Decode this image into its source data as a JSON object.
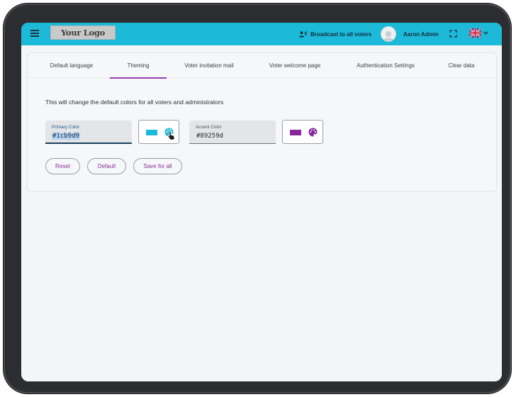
{
  "header": {
    "logo_text": "Your Logo",
    "broadcast_label": "Broadcast to all voters",
    "user_name": "Aaron Admin",
    "primary_color": "#1cb9d9"
  },
  "tabs": [
    {
      "label": "Default language",
      "active": false
    },
    {
      "label": "Theming",
      "active": true
    },
    {
      "label": "Voter invitation mail",
      "active": false
    },
    {
      "label": "Voter welcome page",
      "active": false
    },
    {
      "label": "Authentication Settings",
      "active": false
    },
    {
      "label": "Clear data",
      "active": false
    }
  ],
  "theming": {
    "description": "This will change the default colors for all voters and administrators",
    "primary": {
      "label": "Primary Color",
      "value": "#1cb9d9",
      "swatch": "#1cb9d9"
    },
    "accent": {
      "label": "Accent Color",
      "value": "#89259d",
      "swatch": "#89259d"
    },
    "buttons": {
      "reset": "Reset",
      "default": "Default",
      "save": "Save for all"
    }
  },
  "icons": [
    "menu-icon",
    "broadcast-icon",
    "avatar-icon",
    "fullscreen-icon",
    "uk-flag-icon",
    "chevron-down-icon",
    "palette-icon",
    "pointer-cursor-icon"
  ]
}
